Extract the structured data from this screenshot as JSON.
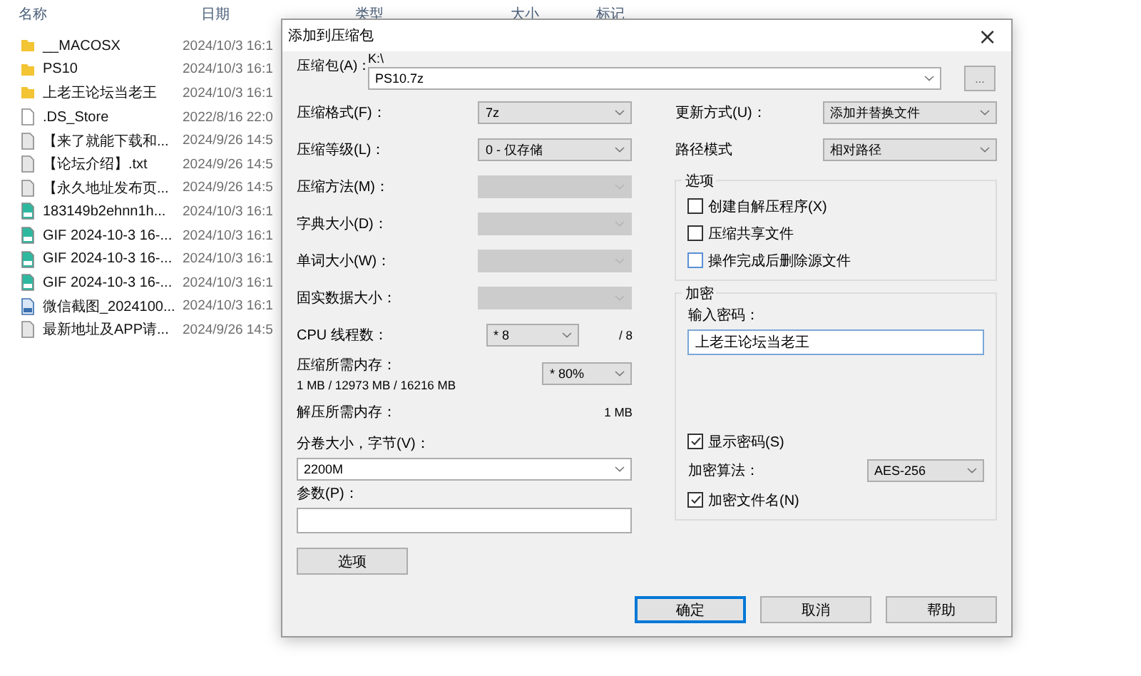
{
  "explorer": {
    "columns": [
      "名称",
      "日期",
      "类型",
      "大小",
      "标记"
    ],
    "files": [
      {
        "name": "__MACOSX",
        "date": "2024/10/3 16:1",
        "kind": "folder"
      },
      {
        "name": "PS10",
        "date": "2024/10/3 16:1",
        "kind": "folder"
      },
      {
        "name": "上老王论坛当老王",
        "date": "2024/10/3 16:1",
        "kind": "folder"
      },
      {
        "name": ".DS_Store",
        "date": "2022/8/16 22:0",
        "kind": "file"
      },
      {
        "name": "【来了就能下载和...",
        "date": "2024/9/26 14:5",
        "kind": "text"
      },
      {
        "name": "【论坛介绍】.txt",
        "date": "2024/9/26 14:5",
        "kind": "text"
      },
      {
        "name": "【永久地址发布页...",
        "date": "2024/9/26 14:5",
        "kind": "text"
      },
      {
        "name": "183149b2ehnn1h...",
        "date": "2024/10/3 16:1",
        "kind": "gif"
      },
      {
        "name": "GIF 2024-10-3 16-...",
        "date": "2024/10/3 16:1",
        "kind": "gif"
      },
      {
        "name": "GIF 2024-10-3 16-...",
        "date": "2024/10/3 16:1",
        "kind": "gif"
      },
      {
        "name": "GIF 2024-10-3 16-...",
        "date": "2024/10/3 16:1",
        "kind": "gif"
      },
      {
        "name": "微信截图_2024100...",
        "date": "2024/10/3 16:1",
        "kind": "image"
      },
      {
        "name": "最新地址及APP请...",
        "date": "2024/9/26 14:5",
        "kind": "text"
      }
    ]
  },
  "dialog": {
    "title": "添加到压缩包",
    "close": "×",
    "archive": {
      "label": "压缩包(A)：",
      "path": "K:\\",
      "value": "PS10.7z",
      "browse": "..."
    },
    "settings": [
      {
        "label": "压缩格式(F)：",
        "value": "7z",
        "disabled": false
      },
      {
        "label": "压缩等级(L)：",
        "value": "0 - 仅存储",
        "disabled": false
      },
      {
        "label": "压缩方法(M)：",
        "disabled": true
      },
      {
        "label": "字典大小(D)：",
        "disabled": true
      },
      {
        "label": "单词大小(W)：",
        "disabled": true
      },
      {
        "label": "固实数据大小：",
        "disabled": true
      }
    ],
    "threads": {
      "label": "CPU 线程数：",
      "value": "* 8",
      "max": "/ 8"
    },
    "memory": {
      "label": "压缩所需内存：",
      "detail": "1 MB / 12973 MB / 16216 MB",
      "value": "* 80%"
    },
    "decompress": {
      "label": "解压所需内存：",
      "value": "1 MB"
    },
    "volume": {
      "label": "分卷大小，字节(V)：",
      "value": "2200M"
    },
    "params": {
      "label": "参数(P)："
    },
    "options_button": "选项",
    "update": {
      "label": "更新方式(U)：",
      "value": "添加并替换文件"
    },
    "path_mode": {
      "label": "路径模式",
      "value": "相对路径"
    },
    "options": {
      "title": "选项",
      "items": [
        {
          "label": "创建自解压程序(X)",
          "checked": false
        },
        {
          "label": "压缩共享文件",
          "checked": false
        },
        {
          "label": "操作完成后删除源文件",
          "checked": false
        }
      ]
    },
    "encryption": {
      "title": "加密",
      "password_label": "输入密码：",
      "password": "上老王论坛当老王",
      "show_password": {
        "label": "显示密码(S)",
        "checked": true
      },
      "method_label": "加密算法：",
      "method": "AES-256",
      "encrypt_names": {
        "label": "加密文件名(N)",
        "checked": true
      }
    },
    "buttons": [
      {
        "label": "确定",
        "default": true
      },
      {
        "label": "取消",
        "default": false
      },
      {
        "label": "帮助",
        "default": false
      }
    ]
  }
}
